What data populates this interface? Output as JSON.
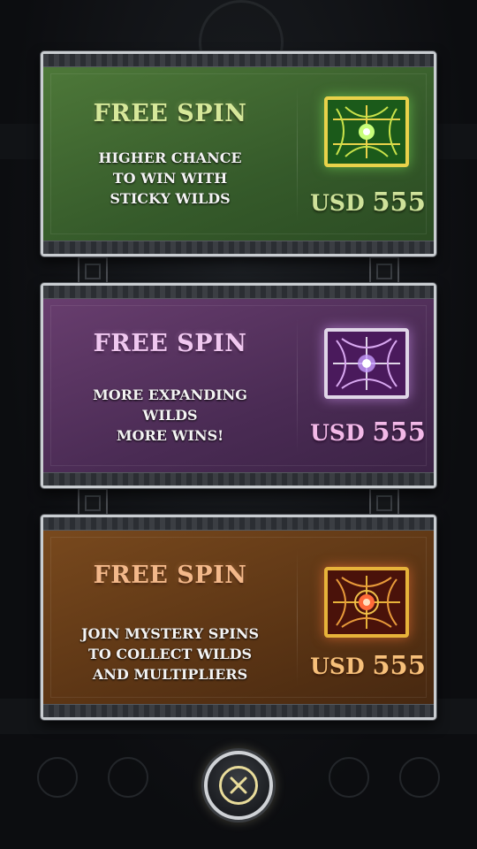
{
  "cards": [
    {
      "theme": "green",
      "title": "FREE SPIN",
      "description_lines": [
        "HIGHER CHANCE",
        "TO WIN WITH",
        "STICKY WILDS"
      ],
      "currency": "USD",
      "amount": "555",
      "icon": "green-chest-icon",
      "accent_color": "#d6e89a"
    },
    {
      "theme": "purple",
      "title": "FREE SPIN",
      "description_lines": [
        "MORE EXPANDING",
        "WILDS",
        "MORE WINS!"
      ],
      "currency": "USD",
      "amount": "555",
      "icon": "purple-chest-icon",
      "accent_color": "#f0c8f0"
    },
    {
      "theme": "orange",
      "title": "FREE SPIN",
      "description_lines": [
        "JOIN MYSTERY SPINS",
        "TO COLLECT WILDS",
        "AND MULTIPLIERS"
      ],
      "currency": "USD",
      "amount": "555",
      "icon": "orange-chest-icon",
      "accent_color": "#f3b88a"
    }
  ],
  "close_button": {
    "icon": "close-icon"
  }
}
